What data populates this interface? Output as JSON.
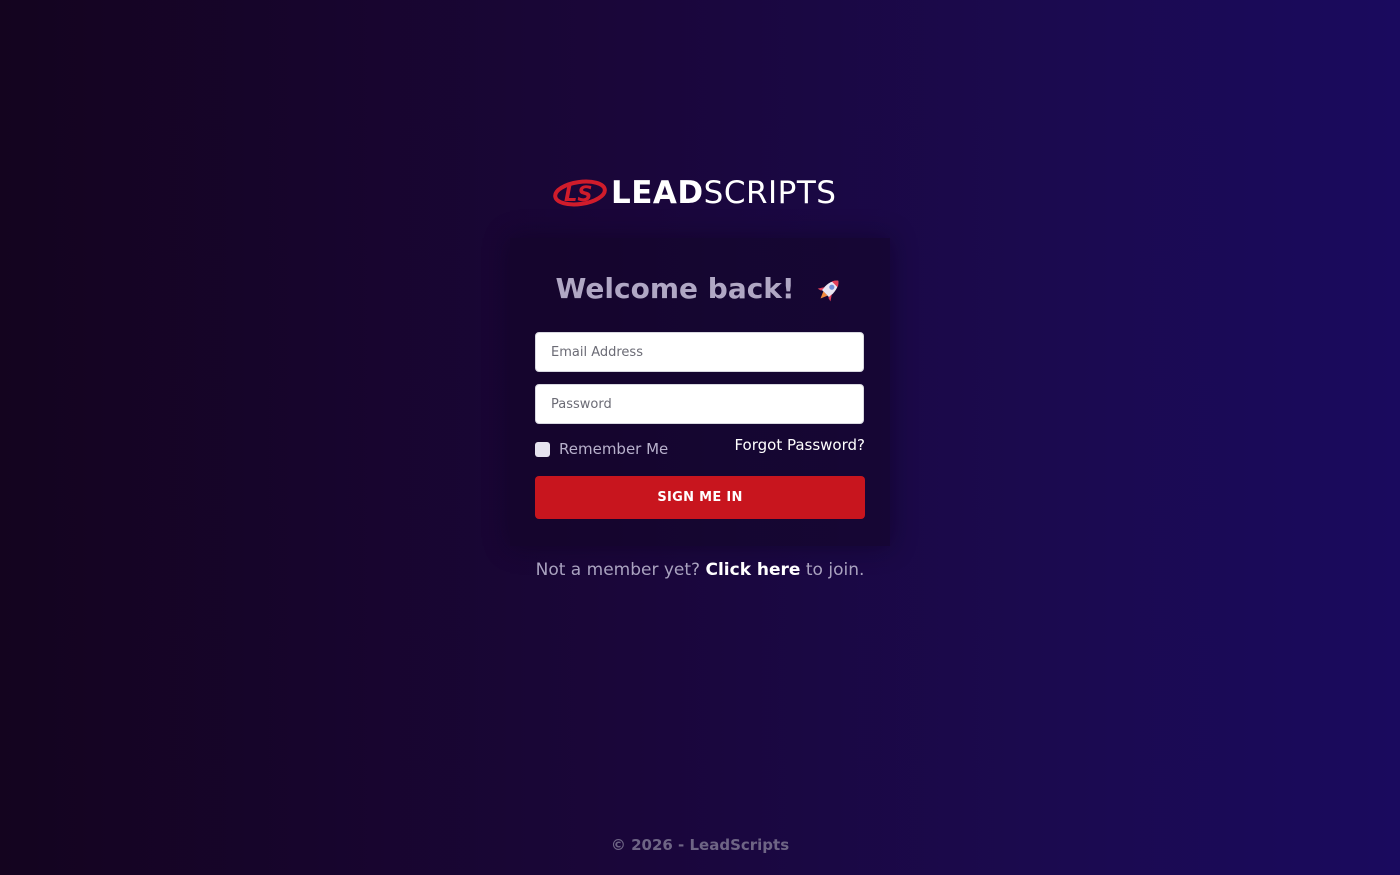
{
  "brand": {
    "logo_text_bold": "LEAD",
    "logo_text_light": "SCRIPTS",
    "mark_icon": "ls-logo-mark-icon",
    "accent_color": "#c8151e"
  },
  "login": {
    "title": "Welcome back!",
    "title_icon": "rocket-icon",
    "email_placeholder": "Email Address",
    "password_placeholder": "Password",
    "remember_label": "Remember Me",
    "forgot_label": "Forgot Password?",
    "submit_label": "SIGN ME IN"
  },
  "signup": {
    "prefix": "Not a member yet?",
    "link_label": "Click here",
    "suffix": "to join."
  },
  "footer": {
    "copyright": "© 2026 - LeadScripts"
  }
}
